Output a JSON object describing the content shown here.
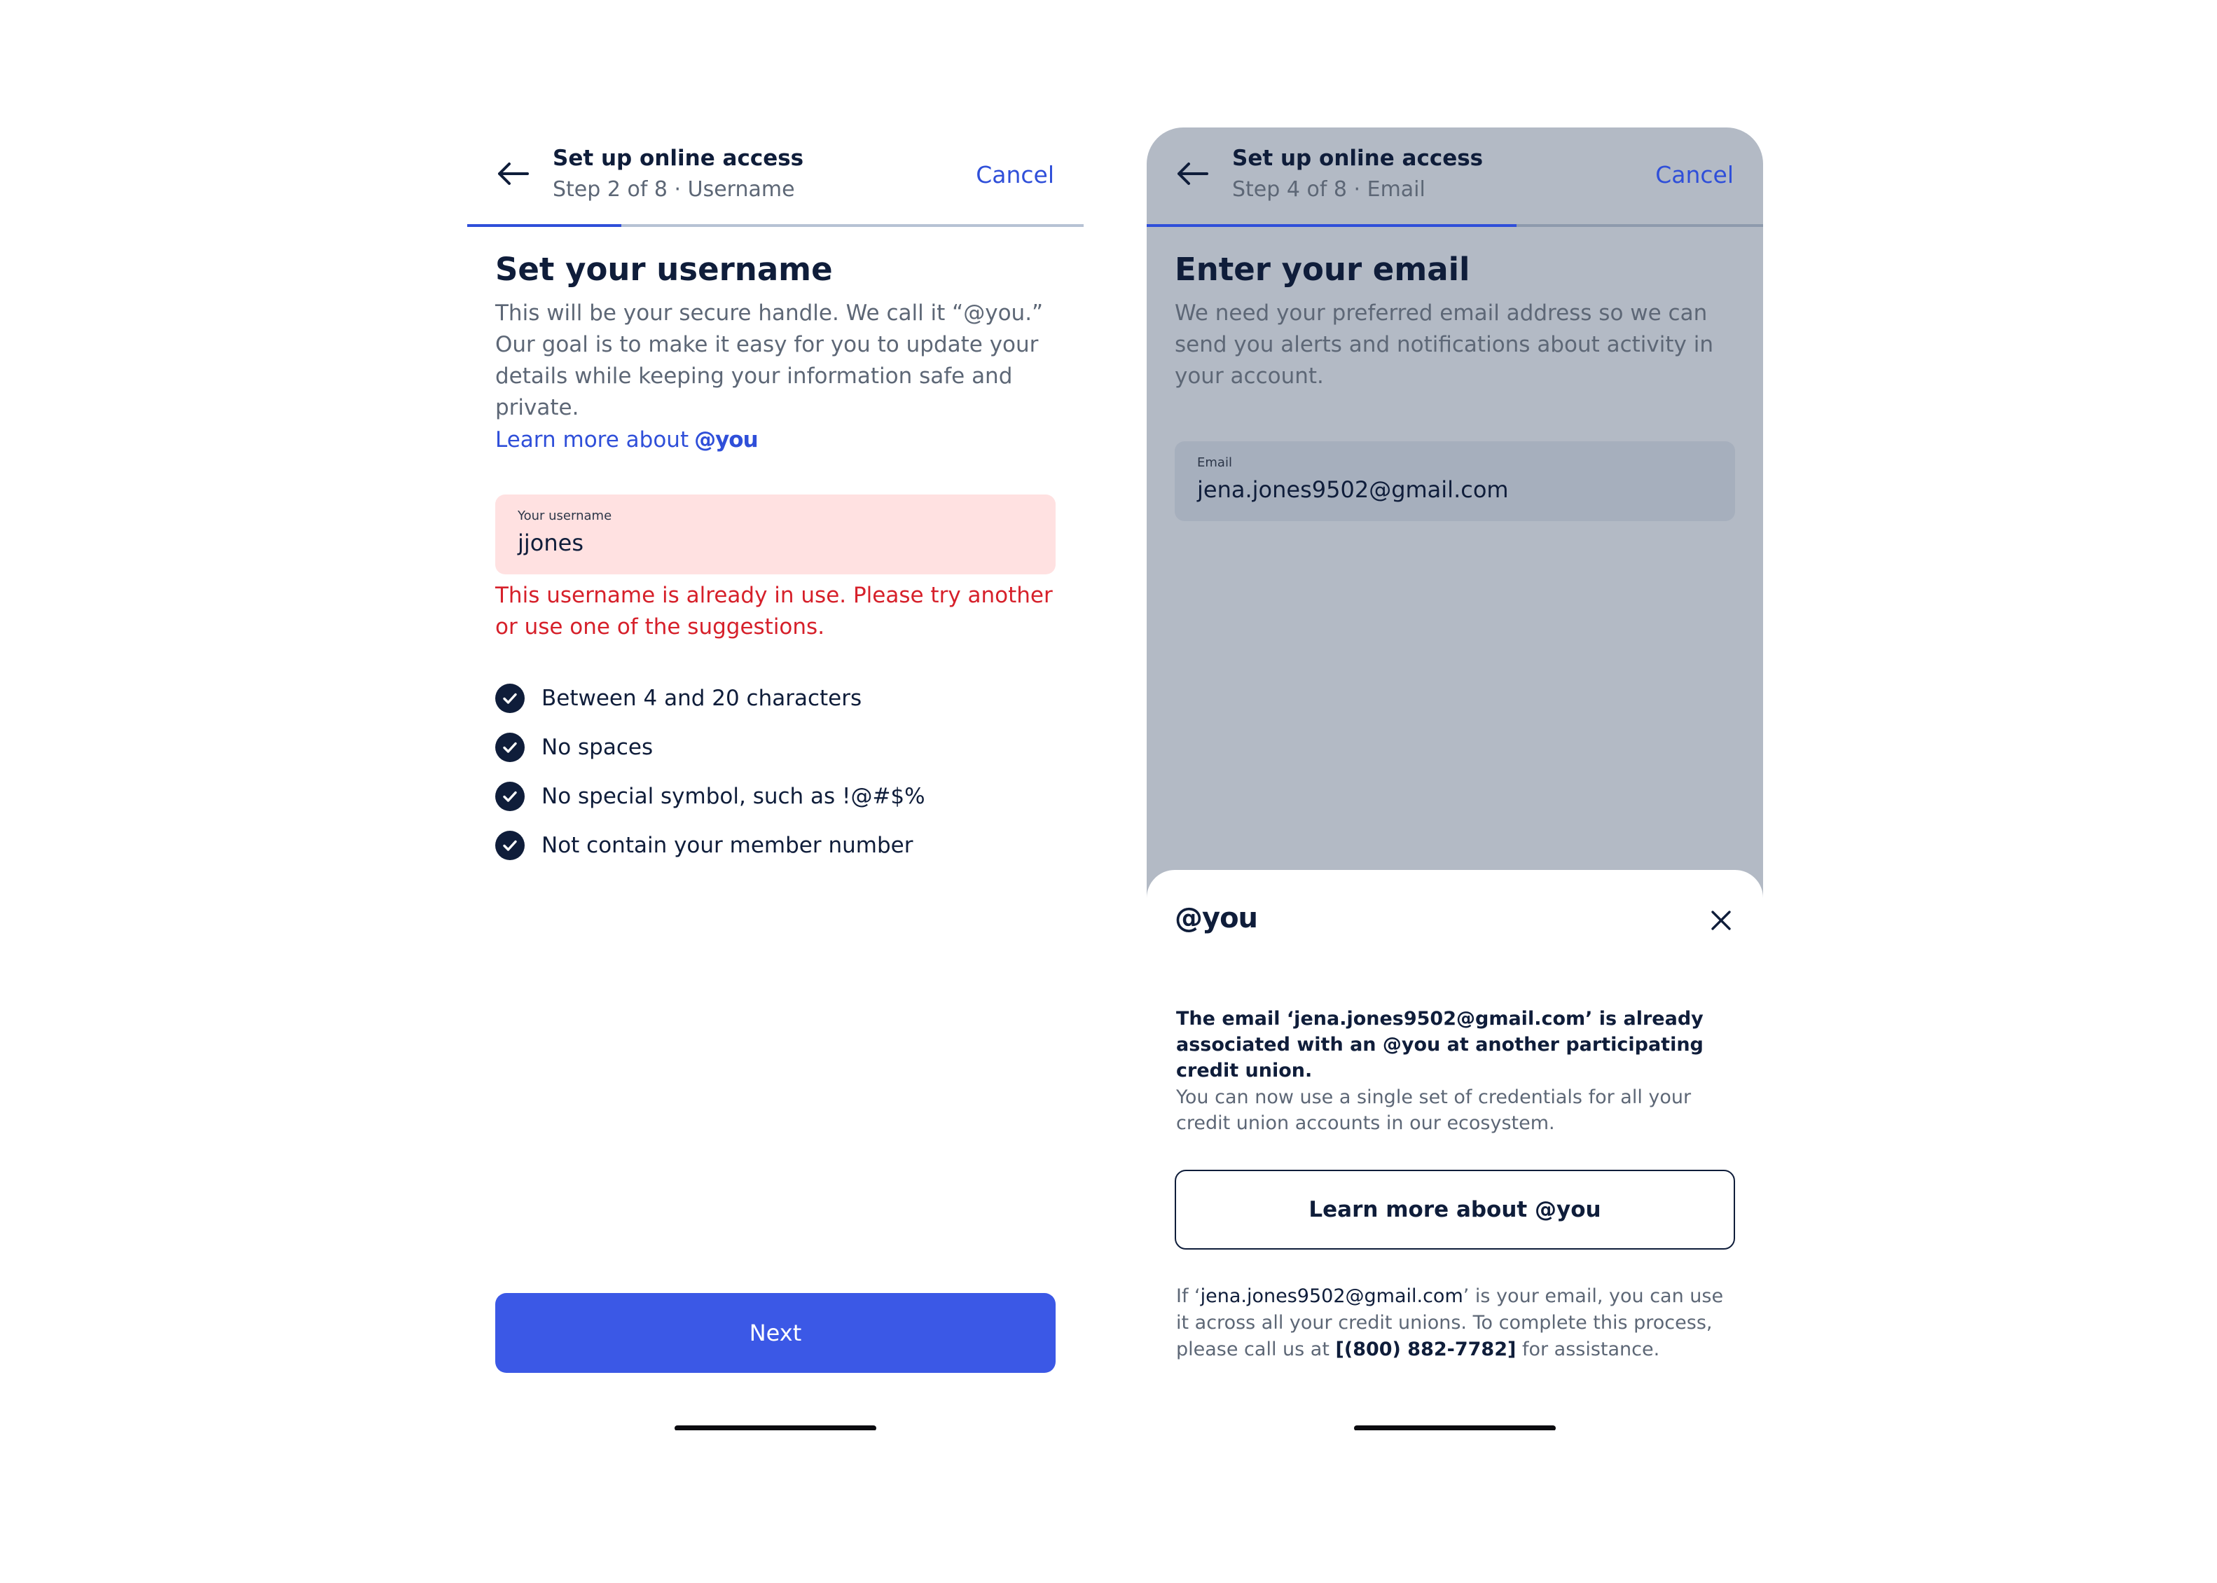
{
  "colors": {
    "accent": "#2f4fd9",
    "primary_button": "#3b58e6",
    "error": "#d6202a",
    "error_field_bg": "#ffe1e1",
    "dimmed_overlay": "#b3bac5",
    "text_dark": "#0f1d3a",
    "text_muted": "#5d6776"
  },
  "screen1": {
    "header": {
      "title": "Set up online access",
      "step": "Step 2 of 8 · Username",
      "cancel": "Cancel",
      "back_icon": "arrow-left-icon",
      "progress": 0.25
    },
    "title": "Set your username",
    "description": "This will be your secure handle. We call it “@you.” Our goal is to make it easy for you to update your details while keeping your information safe and private.",
    "learn_more": {
      "text": "Learn more about",
      "brand": "@you"
    },
    "field": {
      "label": "Your username",
      "value": "jjones"
    },
    "error": "This username is already in use. Please try another or use one of the suggestions.",
    "rules": [
      {
        "label": "Between 4 and 20 characters",
        "icon": "check-circle-icon"
      },
      {
        "label": "No spaces",
        "icon": "check-circle-icon"
      },
      {
        "label": "No special symbol, such as !@#$%",
        "icon": "check-circle-icon"
      },
      {
        "label": "Not contain your member number",
        "icon": "check-circle-icon"
      }
    ],
    "next_button": "Next"
  },
  "screen2": {
    "header": {
      "title": "Set up online access",
      "step": "Step 4 of 8 · Email",
      "cancel": "Cancel",
      "back_icon": "arrow-left-icon",
      "progress": 0.6
    },
    "title": "Enter your email",
    "description": "We need your preferred email address so we can send you alerts and notifications about activity in your account.",
    "field": {
      "label": "Email",
      "value": "jena.jones9502@gmail.com"
    },
    "sheet": {
      "logo": "@you",
      "close_icon": "close-icon",
      "message": "The email ‘jena.jones9502@gmail.com’ is already associated with an @you at another participating credit union.",
      "sub": "You can now use a single set of credentials for all your credit union accounts in our ecosystem.",
      "button": "Learn more about @you",
      "footer": {
        "prefix": "If ‘",
        "email": "jena.jones9502@gmail.com",
        "middle": "’ is your email, you can use it across all your credit unions. To complete this process, please call us at ",
        "phone": "[(800) 882-7782]",
        "suffix": " for assistance."
      }
    }
  }
}
